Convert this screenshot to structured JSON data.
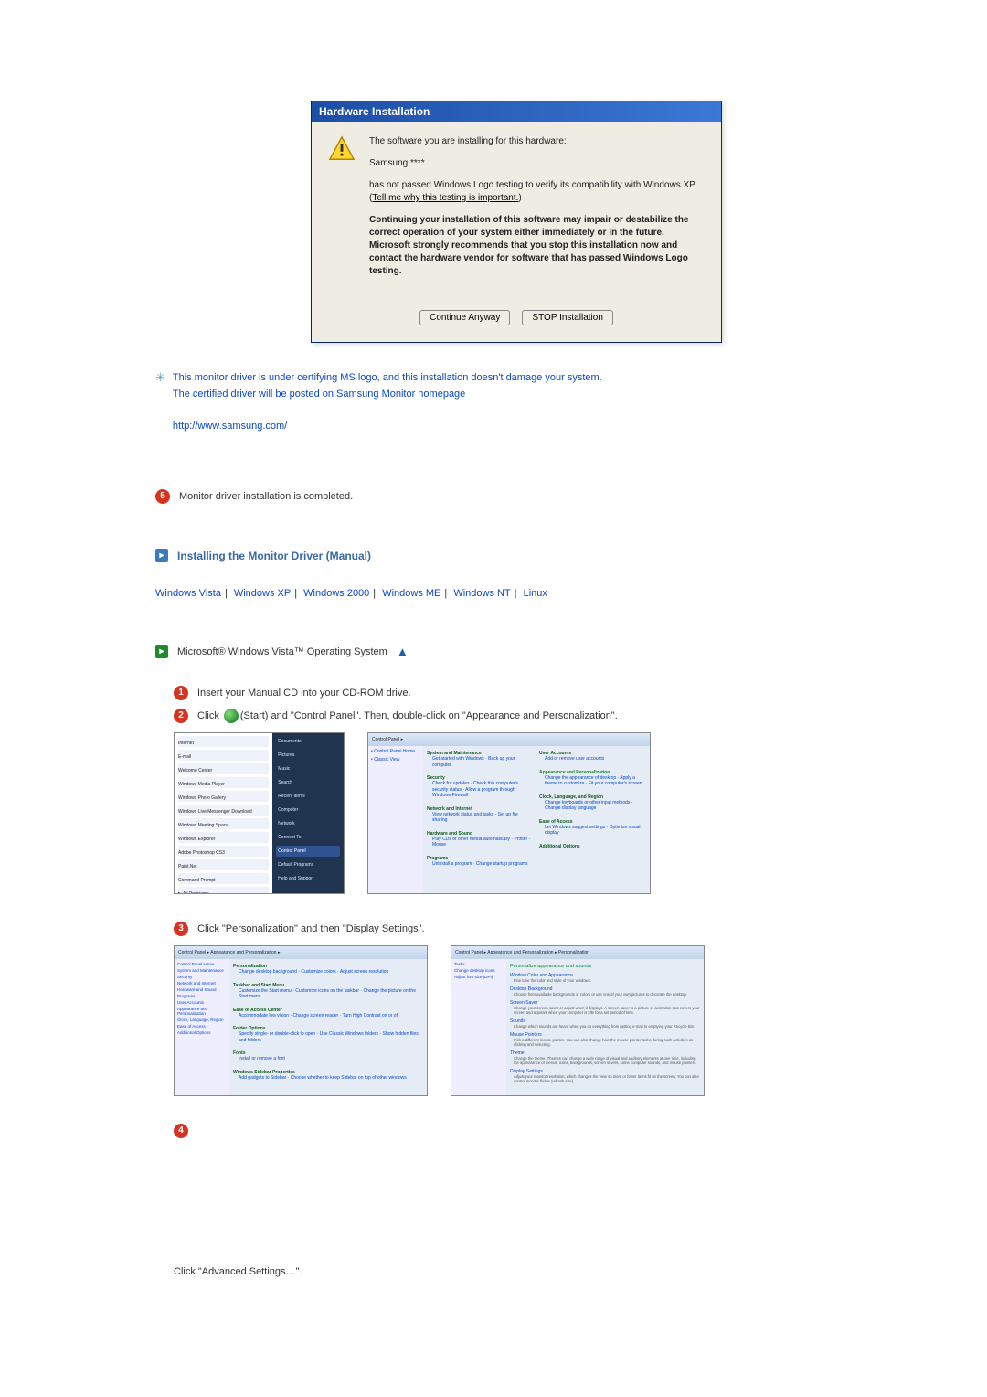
{
  "dialog": {
    "title": "Hardware Installation",
    "line1": "The software you are installing for this hardware:",
    "device": "Samsung ****",
    "line2a": "has not passed Windows Logo testing to verify its compatibility with Windows XP. (",
    "tell_me": "Tell me why this testing is important.",
    "line2b": ")",
    "warn_bold": "Continuing your installation of this software may impair or destabilize the correct operation of your system either immediately or in the future. Microsoft strongly recommends that you stop this installation now and contact the hardware vendor for software that has passed Windows Logo testing.",
    "btn_continue": "Continue Anyway",
    "btn_stop": "STOP Installation"
  },
  "note": {
    "line1": "This monitor driver is under certifying MS logo, and this installation doesn't damage your system.",
    "line2": "The certified driver will be posted on Samsung Monitor homepage",
    "url": "http://www.samsung.com/"
  },
  "step_done": "Monitor driver installation is completed.",
  "section_title": "Installing the Monitor Driver (Manual)",
  "os_links": {
    "vista": "Windows Vista",
    "xp": "Windows XP",
    "w2000": "Windows 2000",
    "me": "Windows ME",
    "nt": "Windows NT",
    "linux": "Linux"
  },
  "vista_block": {
    "lead": "Microsoft® Windows Vista™ Operating System",
    "step1": "Insert your Manual CD into your CD-ROM drive.",
    "step2a": "Click ",
    "step2b": "(Start) and \"Control Panel\". Then, double-click on \"Appearance and Personalization\".",
    "step3": "Click \"Personalization\" and then \"Display Settings\".",
    "step4_text": "Click \"Advanced Settings…\"."
  },
  "start_menu": {
    "left": [
      "Internet",
      "E-mail",
      "Welcome Center",
      "Windows Media Player",
      "Windows Photo Gallery",
      "Windows Live Messenger Download",
      "Windows Meeting Space",
      "Windows Explorer",
      "Adobe Photoshop CS3",
      "Paint.Net",
      "Command Prompt"
    ],
    "right": [
      "Documents",
      "Pictures",
      "Music",
      "Search",
      "Recent Items",
      "Computer",
      "Network",
      "Connect To",
      "Control Panel",
      "Default Programs",
      "Help and Support"
    ],
    "all_programs": "All Programs"
  },
  "control_panel": {
    "address": "Control Panel ▸",
    "side": [
      "Control Panel Home",
      "Classic View"
    ],
    "cats_left": [
      {
        "t": "System and Maintenance",
        "s": "Get started with Windows · Back up your computer"
      },
      {
        "t": "Security",
        "s": "Check for updates · Check this computer's security status · Allow a program through Windows Firewall"
      },
      {
        "t": "Network and Internet",
        "s": "View network status and tasks · Set up file sharing"
      },
      {
        "t": "Hardware and Sound",
        "s": "Play CDs or other media automatically · Printer · Mouse"
      },
      {
        "t": "Programs",
        "s": "Uninstall a program · Change startup programs"
      }
    ],
    "cats_right": [
      {
        "t": "User Accounts",
        "s": "Add or remove user accounts"
      },
      {
        "t": "Appearance and Personalization",
        "s": "Change the appearance of desktop · Apply a theme to customize · Fit your computer's screen",
        "hl": true
      },
      {
        "t": "Clock, Language, and Region",
        "s": "Change keyboards or other input methods · Change display language"
      },
      {
        "t": "Ease of Access",
        "s": "Let Windows suggest settings · Optimize visual display"
      },
      {
        "t": "Additional Options",
        "s": ""
      }
    ]
  },
  "appearance_panel": {
    "address": "Control Panel ▸ Appearance and Personalization ▸",
    "cats": [
      {
        "t": "Personalization",
        "s": "Change desktop background · Customize colors · Adjust screen resolution"
      },
      {
        "t": "Taskbar and Start Menu",
        "s": "Customize the Start menu · Customize icons on the taskbar · Change the picture on the Start menu"
      },
      {
        "t": "Ease of Access Center",
        "s": "Accommodate low vision · Change screen reader · Turn High Contrast on or off"
      },
      {
        "t": "Folder Options",
        "s": "Specify single- or double-click to open · Use Classic Windows folders · Show hidden files and folders"
      },
      {
        "t": "Fonts",
        "s": "Install or remove a font"
      },
      {
        "t": "Windows Sidebar Properties",
        "s": "Add gadgets to Sidebar · Choose whether to keep Sidebar on top of other windows"
      }
    ]
  },
  "personalization_panel": {
    "address": "Control Panel ▸ Appearance and Personalization ▸ Personalization",
    "title": "Personalize appearance and sounds",
    "items": [
      {
        "t": "Window Color and Appearance",
        "s": "Fine tune the color and style of your windows."
      },
      {
        "t": "Desktop Background",
        "s": "Choose from available backgrounds or colors or use one of your own pictures to decorate the desktop."
      },
      {
        "t": "Screen Saver",
        "s": "Change your screen saver or adjust when it displays. A screen saver is a picture or animation that covers your screen and appears when your computer is idle for a set period of time."
      },
      {
        "t": "Sounds",
        "s": "Change which sounds are heard when you do everything from getting e-mail to emptying your Recycle Bin."
      },
      {
        "t": "Mouse Pointers",
        "s": "Pick a different mouse pointer. You can also change how the mouse pointer looks during such activities as clicking and selecting."
      },
      {
        "t": "Theme",
        "s": "Change the theme. Themes can change a wide range of visual and auditory elements at one time, including the appearance of menus, icons, backgrounds, screen savers, some computer sounds, and mouse pointers."
      },
      {
        "t": "Display Settings",
        "s": "Adjust your monitor resolution, which changes the view so more or fewer items fit on the screen. You can also control monitor flicker (refresh rate)."
      }
    ]
  }
}
